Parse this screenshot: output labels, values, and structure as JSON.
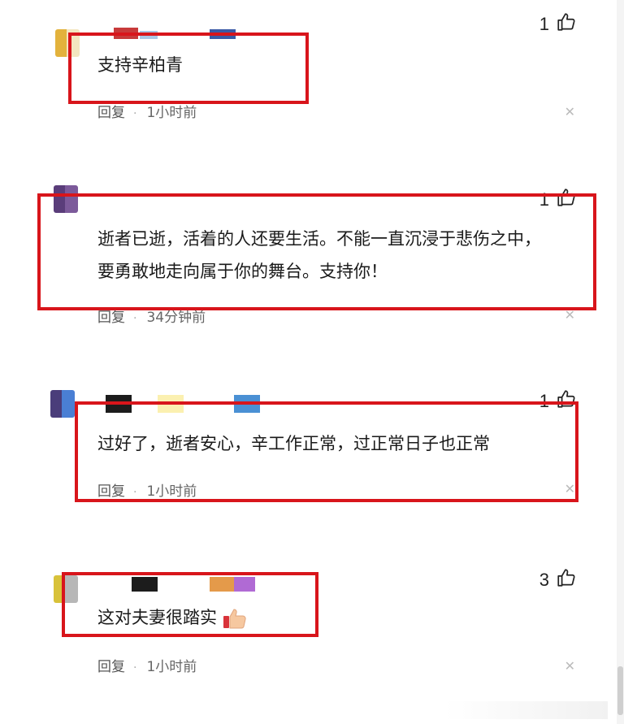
{
  "comments": [
    {
      "text": "支持辛柏青",
      "reply_label": "回复",
      "time": "1小时前",
      "likes": "1",
      "avatar_colors": [
        "#e3b23c",
        "#c9d8e8"
      ]
    },
    {
      "text": "逝者已逝，活着的人还要生活。不能一直沉浸于悲伤之中，要勇敢地走向属于你的舞台。支持你！",
      "reply_label": "回复",
      "time": "34分钟前",
      "likes": "1",
      "avatar_colors": [
        "#5a3d7a",
        "#ffffff"
      ]
    },
    {
      "text": "过好了，逝者安心，辛工作正常，过正常日子也正常",
      "reply_label": "回复",
      "time": "1小时前",
      "likes": "1",
      "avatar_colors": [
        "#5a4a8a",
        "#4a7fd4"
      ]
    },
    {
      "text": "这对夫妻很踏实",
      "reply_label": "回复",
      "time": "1小时前",
      "likes": "3",
      "avatar_colors": [
        "#d8c23a",
        "#eeeeee"
      ]
    }
  ],
  "colors": {
    "highlight": "#d8151b",
    "text": "#1a1a1a",
    "meta": "#555555"
  },
  "icons": {
    "like": "thumbs-up-icon",
    "close": "close-icon",
    "emoji": "thumbs-up-emoji"
  }
}
